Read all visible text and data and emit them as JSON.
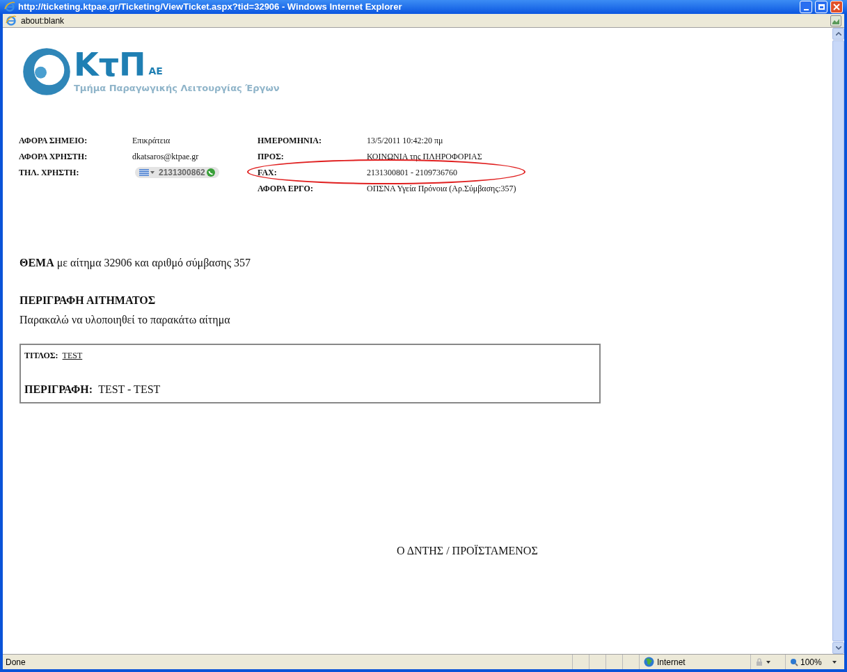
{
  "window": {
    "title": "http://ticketing.ktpae.gr/Ticketing/ViewTicket.aspx?tid=32906 - Windows Internet Explorer"
  },
  "address_bar": {
    "text": "about:blank"
  },
  "logo": {
    "mark": "ΚτΠ",
    "suffix": "ΑΕ",
    "subtitle": "Τμήμα Παραγωγικής Λειτουργίας Έργων"
  },
  "details_left": [
    {
      "kind": "text",
      "label": "ΑΦΟΡΑ ΣΗΜΕΙΟ:",
      "value": "Επικράτεια"
    },
    {
      "kind": "text",
      "label": "ΑΦΟΡΑ ΧΡΗΣΤΗ:",
      "value": "dkatsaros@ktpae.gr"
    },
    {
      "kind": "phone",
      "label": "ΤΗΛ. ΧΡΗΣΤΗ:",
      "value": "2131300862"
    }
  ],
  "details_right": [
    {
      "label": "ΗΜΕΡΟΜΗΝΙΑ:",
      "value": "13/5/2011 10:42:20 πμ",
      "circled": false
    },
    {
      "label": "ΠΡΟΣ:",
      "value": "ΚΟΙΝΩΝΙΑ της ΠΛΗΡΟΦΟΡΙΑΣ",
      "circled": false
    },
    {
      "label": "FAX:",
      "value": "2131300801 - 2109736760",
      "circled": true
    },
    {
      "label": "ΑΦΟΡΑ ΕΡΓΟ:",
      "value": "ΟΠΣΝΑ Υγεία Πρόνοια (Αρ.Σύμβασης:357)",
      "circled": false
    }
  ],
  "subject": "**ΘΕΜΑ** με αίτημα 32906 και αριθμό σύμβασης 357",
  "description_heading": "ΠΕΡΙΓΡΑΦΗ ΑΙΤΗΜΑΤΟΣ",
  "description_text": "Παρακαλώ να υλοποιηθεί το παρακάτω αίτημα",
  "request_box": {
    "title_label": "ΤΙΤΛΟΣ:",
    "title_value": "TEST",
    "description_label": "ΠΕΡΙΓΡΑΦΗ:",
    "description_value": "TEST - TEST"
  },
  "signature": "Ο ΔΝΤΗΣ / ΠΡΟΪΣΤΑΜΕΝΟΣ",
  "status_bar": {
    "status": "Done",
    "zone": "Internet",
    "zoom": "100%"
  }
}
